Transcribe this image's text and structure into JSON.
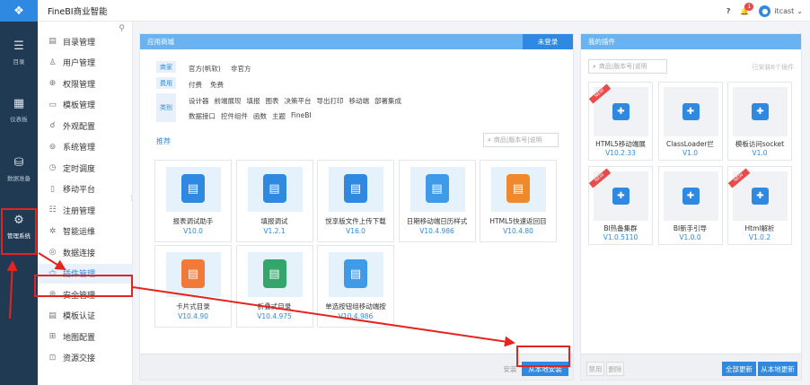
{
  "header": {
    "title": "FineBI商业智能",
    "user": "itcast",
    "notif_count": "1"
  },
  "rail": [
    {
      "label": "目录",
      "icon": "list-icon"
    },
    {
      "label": "仪表板",
      "icon": "dashboard-icon"
    },
    {
      "label": "数据准备",
      "icon": "database-icon"
    },
    {
      "label": "管理系统",
      "icon": "gear-icon"
    }
  ],
  "sidebar": {
    "items": [
      {
        "label": "目录管理",
        "icon": "folder-list-icon"
      },
      {
        "label": "用户管理",
        "icon": "user-icon"
      },
      {
        "label": "权限管理",
        "icon": "lock-icon"
      },
      {
        "label": "模板管理",
        "icon": "template-icon"
      },
      {
        "label": "外观配置",
        "icon": "appearance-icon"
      },
      {
        "label": "系统管理",
        "icon": "system-icon"
      },
      {
        "label": "定时调度",
        "icon": "clock-icon"
      },
      {
        "label": "移动平台",
        "icon": "mobile-icon"
      },
      {
        "label": "注册管理",
        "icon": "register-icon"
      },
      {
        "label": "智能运维",
        "icon": "ops-icon"
      },
      {
        "label": "数据连接",
        "icon": "link-icon"
      },
      {
        "label": "插件管理",
        "icon": "plugin-icon"
      },
      {
        "label": "安全管理",
        "icon": "shield-icon"
      },
      {
        "label": "模板认证",
        "icon": "cert-icon"
      },
      {
        "label": "地图配置",
        "icon": "map-icon"
      },
      {
        "label": "资源交接",
        "icon": "handover-icon"
      }
    ],
    "active_index": 11
  },
  "store": {
    "title": "应用商城",
    "login": "未登录",
    "filters": {
      "vendor_label": "商家",
      "vendor_opts": [
        "官方(帆软)",
        "非官方"
      ],
      "fee_label": "费用",
      "fee_opts": [
        "付费",
        "免费"
      ],
      "category_label": "类别",
      "category_row1": [
        "设计器",
        "前端展现",
        "填报",
        "图表",
        "决策平台",
        "导出打印",
        "移动端",
        "部署集成"
      ],
      "category_row2": [
        "数据接口",
        "控件组件",
        "函数",
        "主题",
        "FineBI"
      ]
    },
    "recommend": "推荐",
    "search_placeholder": "商品|版本号|说明",
    "cards": [
      {
        "name": "报表调试助手",
        "version": "V10.0",
        "color": "#2f89e0"
      },
      {
        "name": "填报调试",
        "version": "V1.2.1",
        "color": "#2f89e0"
      },
      {
        "name": "悦享版文件上传下载",
        "version": "V16.0",
        "color": "#2f89e0"
      },
      {
        "name": "日期移动端日历样式",
        "version": "V10.4.986",
        "color": "#3f9be8"
      },
      {
        "name": "HTML5快速返回目",
        "version": "V10.4.80",
        "color": "#f0892b"
      },
      {
        "name": "卡片式目录",
        "version": "V10.4.90",
        "color": "#f07a3a"
      },
      {
        "name": "折叠式目录",
        "version": "V10.4.975",
        "color": "#34a56b"
      },
      {
        "name": "单选按钮组移动端按",
        "version": "V10.4.986",
        "color": "#3f9be8"
      }
    ],
    "footer": {
      "install": "安装",
      "local_install": "从本地安装"
    }
  },
  "mine": {
    "title": "我的插件",
    "search_placeholder": "商品|版本号|说明",
    "installed": "已安装6个插件",
    "new_tag": "NEW",
    "cards": [
      {
        "name": "HTML5移动端展",
        "version": "V10.2.33",
        "new": true
      },
      {
        "name": "ClassLoader拦",
        "version": "V1.0",
        "new": false
      },
      {
        "name": "模板访问socket",
        "version": "V1.0",
        "new": false
      },
      {
        "name": "BI热备集群",
        "version": "V1.0.5110",
        "new": true
      },
      {
        "name": "BI新手引导",
        "version": "V1.0.0",
        "new": false
      },
      {
        "name": "Html解析",
        "version": "V1.0.2",
        "new": true
      }
    ],
    "footer": {
      "disable": "禁用",
      "delete": "删除",
      "update_all": "全部更新",
      "local_update": "从本地更新"
    }
  },
  "colors": {
    "accent": "#2f89e0",
    "highlight": "#e5231f",
    "rail_bg": "#1f3a52"
  }
}
